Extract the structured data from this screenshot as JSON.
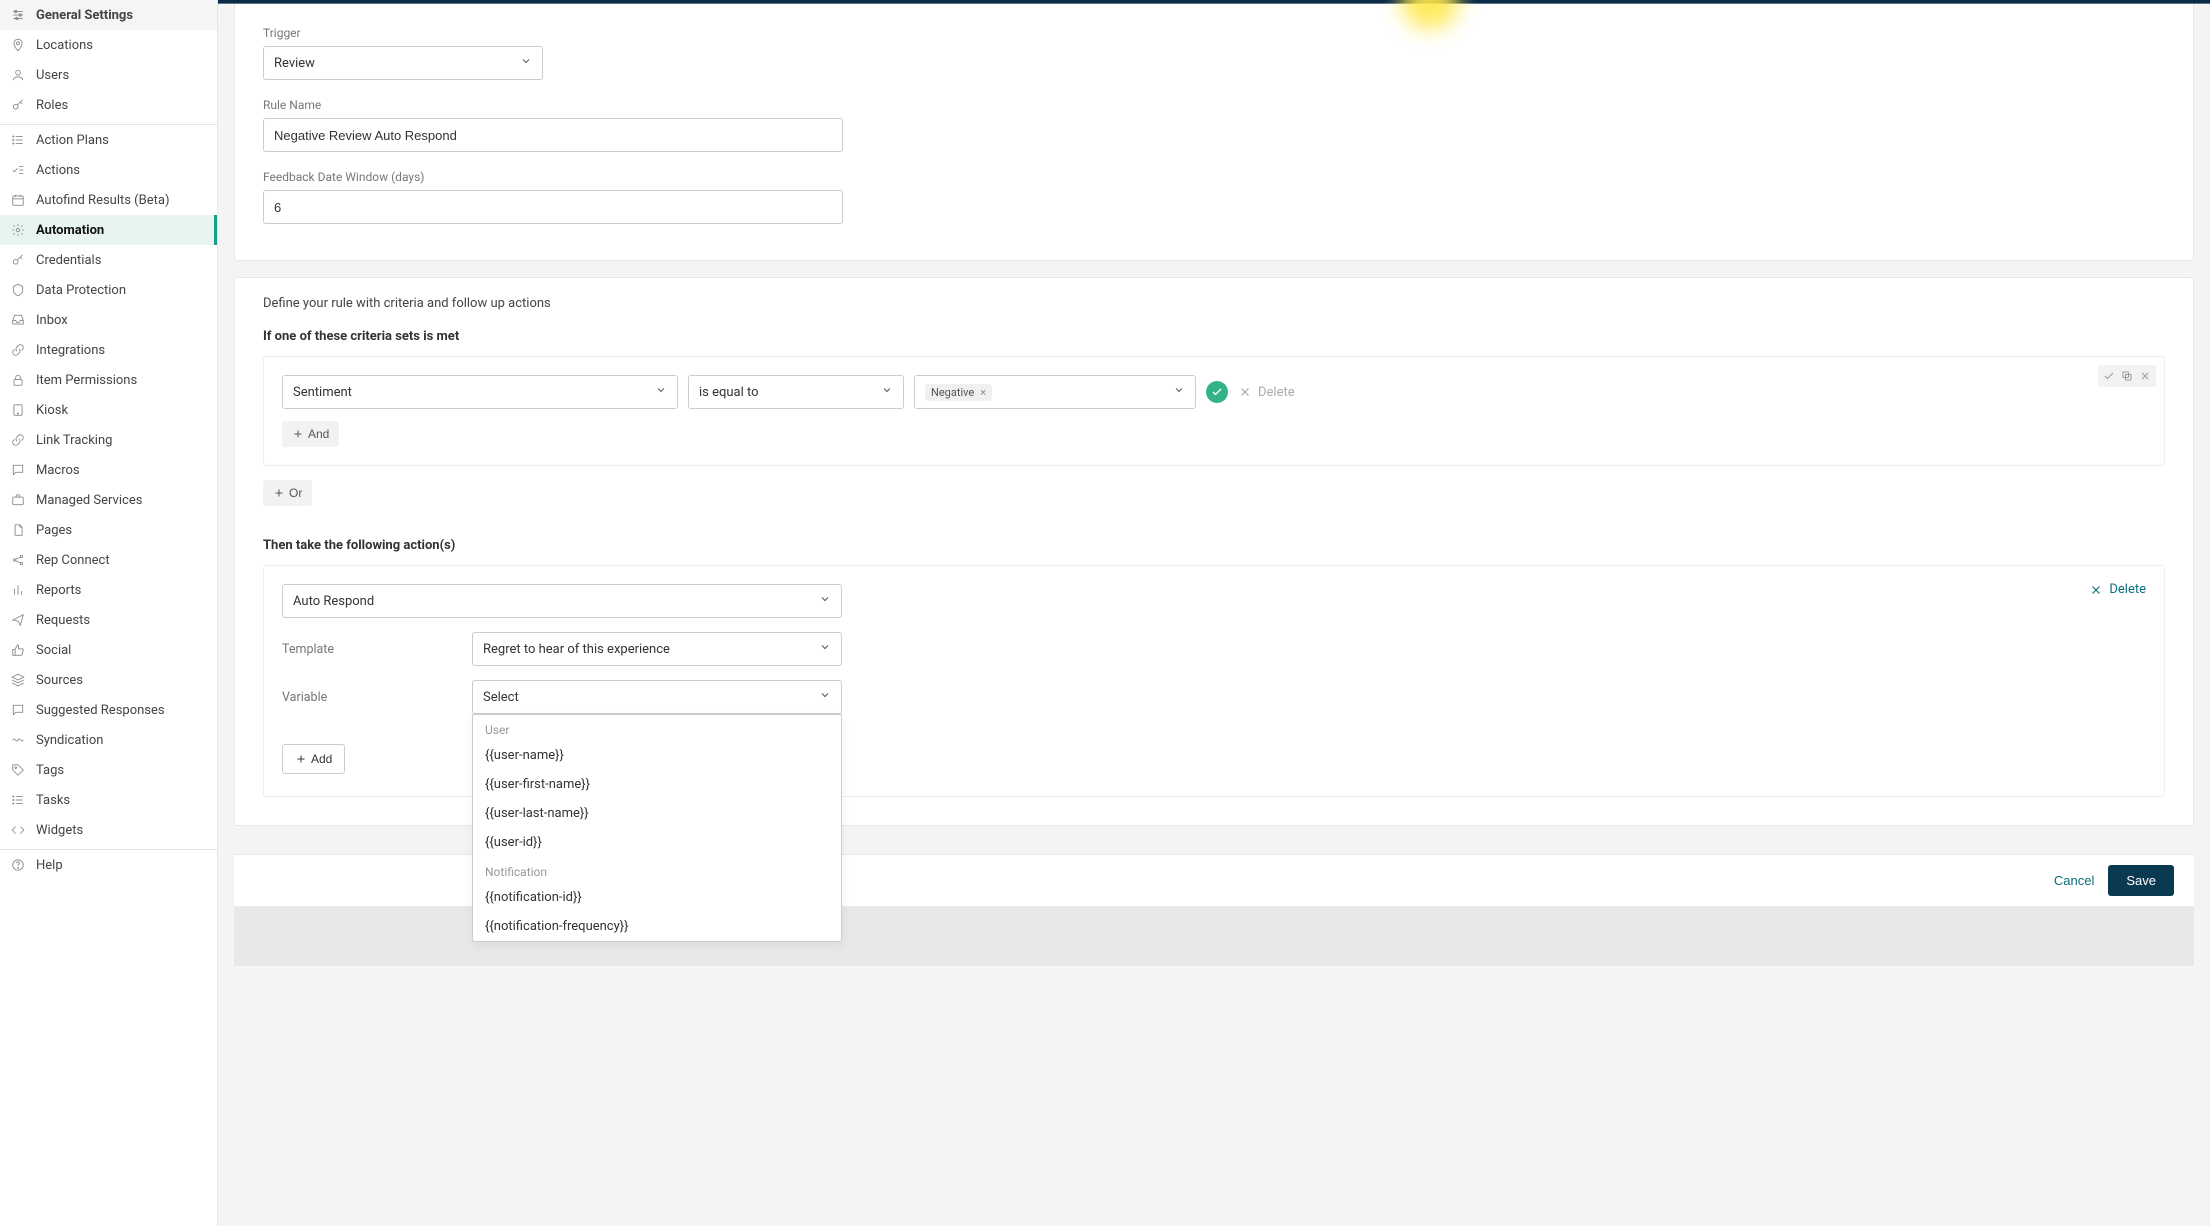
{
  "sidebar": {
    "items": [
      {
        "key": "general-settings",
        "label": "General Settings",
        "icon": "sliders",
        "active": true,
        "section": 0
      },
      {
        "key": "locations",
        "label": "Locations",
        "icon": "map-pin",
        "section": 0
      },
      {
        "key": "users",
        "label": "Users",
        "icon": "user",
        "section": 0
      },
      {
        "key": "roles",
        "label": "Roles",
        "icon": "key",
        "section": 0
      },
      {
        "key": "action-plans",
        "label": "Action Plans",
        "icon": "list",
        "section": 1
      },
      {
        "key": "actions",
        "label": "Actions",
        "icon": "checklist",
        "section": 1
      },
      {
        "key": "autofind",
        "label": "Autofind Results (Beta)",
        "icon": "calendar",
        "section": 1
      },
      {
        "key": "automation",
        "label": "Automation",
        "icon": "gear",
        "active": true,
        "section": 1
      },
      {
        "key": "credentials",
        "label": "Credentials",
        "icon": "key",
        "section": 1
      },
      {
        "key": "data-protection",
        "label": "Data Protection",
        "icon": "shield",
        "section": 1
      },
      {
        "key": "inbox",
        "label": "Inbox",
        "icon": "inbox",
        "section": 1
      },
      {
        "key": "integrations",
        "label": "Integrations",
        "icon": "link",
        "section": 1
      },
      {
        "key": "item-permissions",
        "label": "Item Permissions",
        "icon": "lock",
        "section": 1
      },
      {
        "key": "kiosk",
        "label": "Kiosk",
        "icon": "tablet",
        "section": 1
      },
      {
        "key": "link-tracking",
        "label": "Link Tracking",
        "icon": "link",
        "section": 1
      },
      {
        "key": "macros",
        "label": "Macros",
        "icon": "chat",
        "section": 1
      },
      {
        "key": "managed-services",
        "label": "Managed Services",
        "icon": "briefcase",
        "section": 1
      },
      {
        "key": "pages",
        "label": "Pages",
        "icon": "doc",
        "section": 1
      },
      {
        "key": "rep-connect",
        "label": "Rep Connect",
        "icon": "share",
        "section": 1
      },
      {
        "key": "reports",
        "label": "Reports",
        "icon": "bar",
        "section": 1
      },
      {
        "key": "requests",
        "label": "Requests",
        "icon": "send",
        "section": 1
      },
      {
        "key": "social",
        "label": "Social",
        "icon": "thumb",
        "section": 1
      },
      {
        "key": "sources",
        "label": "Sources",
        "icon": "stack",
        "section": 1
      },
      {
        "key": "suggested-responses",
        "label": "Suggested Responses",
        "icon": "chat",
        "section": 1
      },
      {
        "key": "syndication",
        "label": "Syndication",
        "icon": "wave",
        "section": 1
      },
      {
        "key": "tags",
        "label": "Tags",
        "icon": "tag",
        "section": 1
      },
      {
        "key": "tasks",
        "label": "Tasks",
        "icon": "list",
        "section": 1
      },
      {
        "key": "widgets",
        "label": "Widgets",
        "icon": "code",
        "section": 1
      },
      {
        "key": "help",
        "label": "Help",
        "icon": "help",
        "section": 2
      }
    ]
  },
  "form": {
    "trigger_label": "Trigger",
    "trigger_value": "Review",
    "rule_name_label": "Rule Name",
    "rule_name_value": "Negative Review Auto Respond",
    "feedback_window_label": "Feedback Date Window (days)",
    "feedback_window_value": "6"
  },
  "rules": {
    "intro": "Define your rule with criteria and follow up actions",
    "criteria_heading": "If one of these criteria sets is met",
    "criteria": {
      "field": "Sentiment",
      "operator": "is equal to",
      "value_tag": "Negative",
      "and_label": "And",
      "or_label": "Or",
      "delete_label": "Delete"
    },
    "actions_heading": "Then take the following action(s)",
    "action": {
      "type": "Auto Respond",
      "template_label": "Template",
      "template_value": "Regret to hear of this experience",
      "variable_label": "Variable",
      "variable_value": "Select",
      "add_label": "Add",
      "delete_label": "Delete"
    },
    "variable_dropdown": {
      "groups": [
        {
          "label": "User",
          "options": [
            "{{user-name}}",
            "{{user-first-name}}",
            "{{user-last-name}}",
            "{{user-id}}"
          ]
        },
        {
          "label": "Notification",
          "options": [
            "{{notification-id}}",
            "{{notification-frequency}}"
          ]
        }
      ]
    }
  },
  "footer": {
    "cancel": "Cancel",
    "save": "Save"
  }
}
